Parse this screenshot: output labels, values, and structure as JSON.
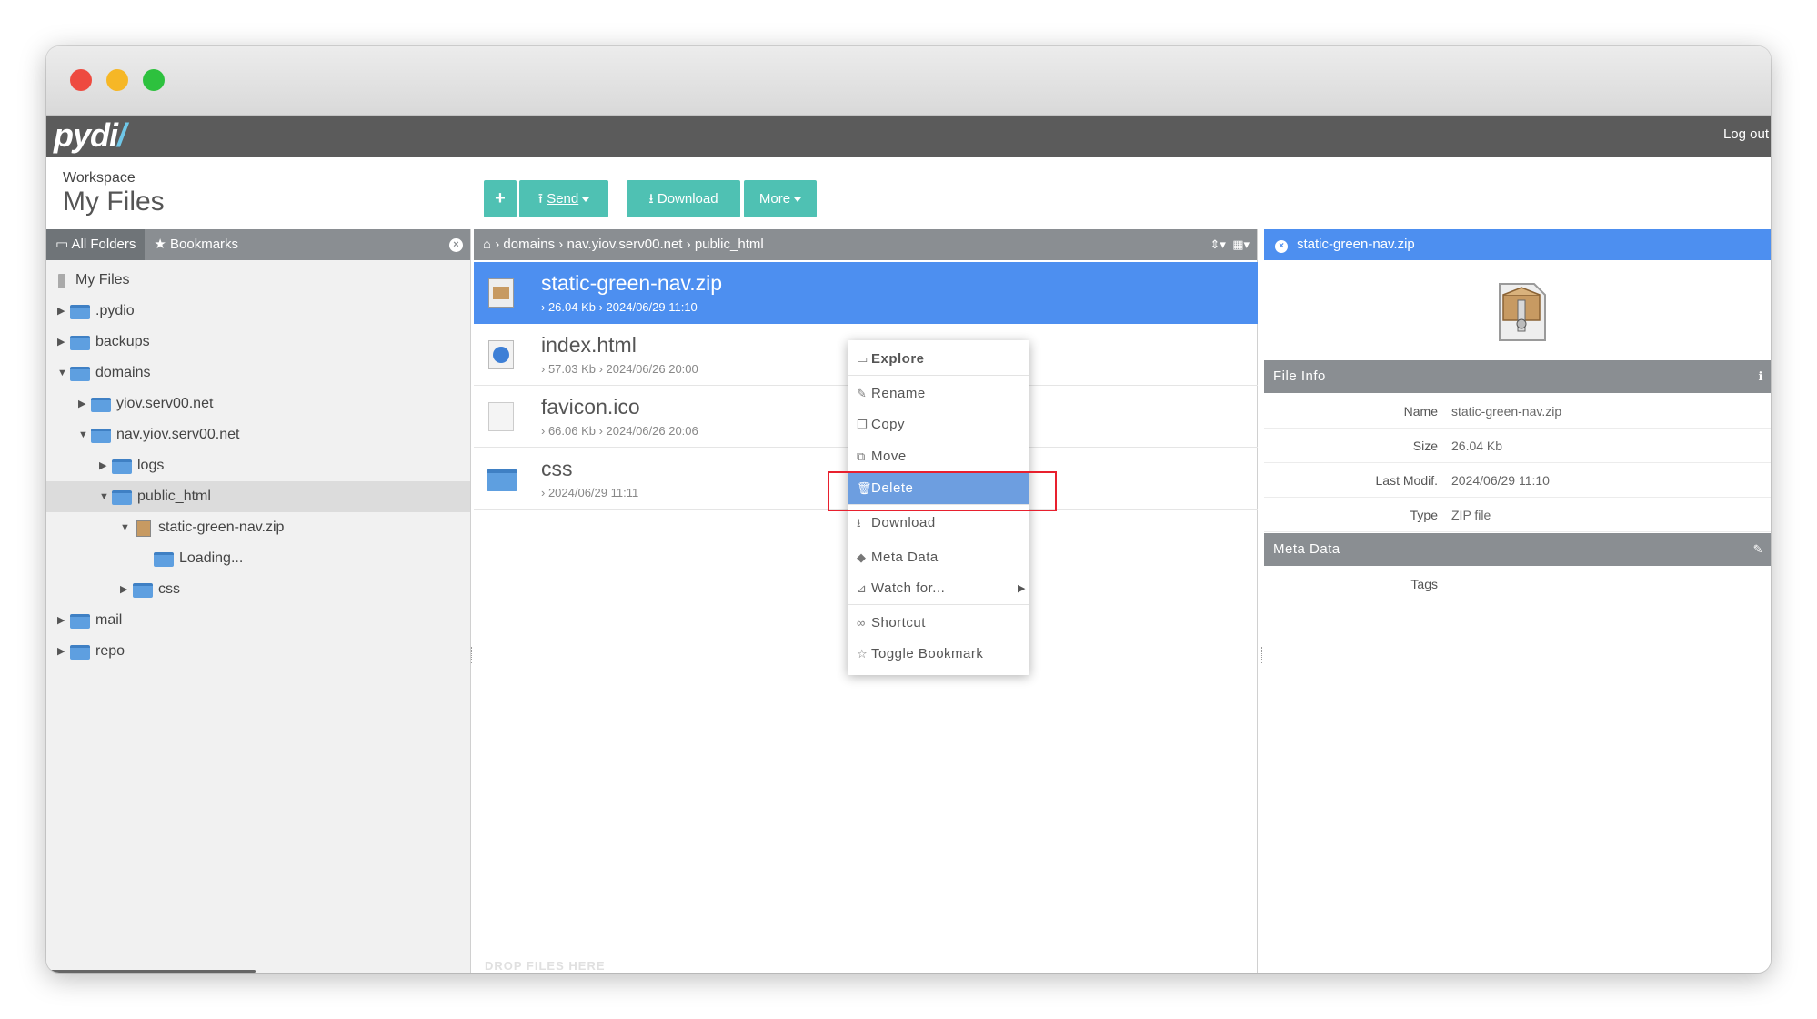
{
  "app": {
    "logo_text": "pydi",
    "logout_label": "Log out"
  },
  "workspace": {
    "label": "Workspace",
    "title": "My Files"
  },
  "toolbar": {
    "add_icon": "plus-icon",
    "send_label": "Send",
    "download_label": "Download",
    "more_label": "More"
  },
  "left_panel": {
    "tabs": [
      "All Folders",
      "Bookmarks"
    ],
    "tree": [
      {
        "label": "My Files",
        "depth": 0,
        "expand": "none",
        "icon": "hdd-icon"
      },
      {
        "label": ".pydio",
        "depth": 0,
        "expand": "collapsed",
        "icon": "folder-icon"
      },
      {
        "label": "backups",
        "depth": 0,
        "expand": "collapsed",
        "icon": "folder-icon"
      },
      {
        "label": "domains",
        "depth": 0,
        "expand": "expanded",
        "icon": "folder-icon"
      },
      {
        "label": "yiov.serv00.net",
        "depth": 1,
        "expand": "collapsed",
        "icon": "folder-icon"
      },
      {
        "label": "nav.yiov.serv00.net",
        "depth": 1,
        "expand": "expanded",
        "icon": "folder-icon"
      },
      {
        "label": "logs",
        "depth": 2,
        "expand": "collapsed",
        "icon": "folder-icon"
      },
      {
        "label": "public_html",
        "depth": 2,
        "expand": "expanded",
        "icon": "folder-icon",
        "selected": true
      },
      {
        "label": "static-green-nav.zip",
        "depth": 3,
        "expand": "expanded",
        "icon": "zip-icon"
      },
      {
        "label": "Loading...",
        "depth": 4,
        "expand": "none",
        "icon": "folder-icon"
      },
      {
        "label": "css",
        "depth": 3,
        "expand": "collapsed",
        "icon": "folder-icon"
      },
      {
        "label": "mail",
        "depth": 0,
        "expand": "collapsed",
        "icon": "folder-icon"
      },
      {
        "label": "repo",
        "depth": 0,
        "expand": "collapsed",
        "icon": "folder-icon"
      }
    ]
  },
  "breadcrumb": {
    "parts": [
      "domains",
      "nav.yiov.serv00.net",
      "public_html"
    ]
  },
  "files": [
    {
      "name": "static-green-nav.zip",
      "size": "26.04 Kb",
      "date": "2024/06/29 11:10",
      "icon": "zip-icon",
      "selected": true
    },
    {
      "name": "index.html",
      "size": "57.03 Kb",
      "date": "2024/06/26 20:00",
      "icon": "html-icon"
    },
    {
      "name": "favicon.ico",
      "size": "66.06 Kb",
      "date": "2024/06/26 20:06",
      "icon": "file-icon"
    },
    {
      "name": "css",
      "size": "",
      "date": "2024/06/29 11:11",
      "icon": "folder-icon"
    }
  ],
  "drop_hint": "DROP FILES HERE",
  "context_menu": {
    "items": [
      {
        "label": "Explore",
        "icon": "folder-open-icon",
        "bold": true
      },
      {
        "label": "Rename",
        "icon": "pencil-icon"
      },
      {
        "label": "Copy",
        "icon": "copy-icon"
      },
      {
        "label": "Move",
        "icon": "move-icon"
      },
      {
        "label": "Delete",
        "icon": "trash-icon",
        "highlight": true
      },
      {
        "label": "Download",
        "icon": "download-icon"
      },
      {
        "label": "Meta Data",
        "icon": "tags-icon"
      },
      {
        "label": "Watch for...",
        "icon": "rss-icon",
        "submenu": true
      },
      {
        "label": "Shortcut",
        "icon": "link-icon"
      },
      {
        "label": "Toggle Bookmark",
        "icon": "star-icon"
      }
    ]
  },
  "details": {
    "title": "static-green-nav.zip",
    "file_info_label": "File Info",
    "meta_label": "Meta Data",
    "info": [
      {
        "key": "Name",
        "value": "static-green-nav.zip"
      },
      {
        "key": "Size",
        "value": "26.04 Kb"
      },
      {
        "key": "Last Modif.",
        "value": "2024/06/29 11:10"
      },
      {
        "key": "Type",
        "value": "ZIP file"
      }
    ],
    "meta": [
      {
        "key": "Tags",
        "value": ""
      }
    ]
  },
  "colors": {
    "accent": "#4fc1b3",
    "selection": "#4d8ff0",
    "menu_highlight": "#6d9ee0",
    "annotation": "#e8202e",
    "header": "#5b5b5b"
  }
}
